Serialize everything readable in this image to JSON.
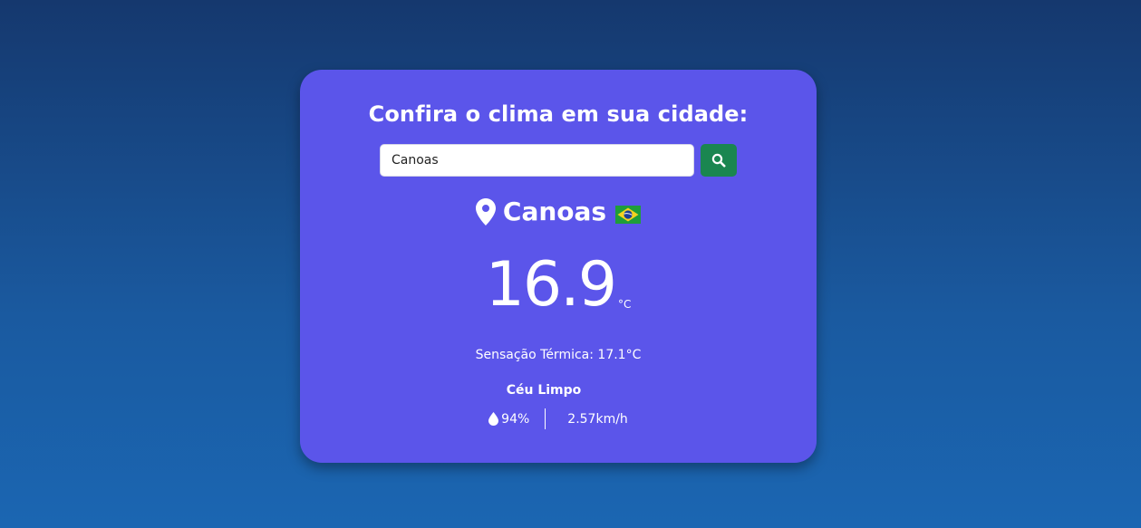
{
  "card": {
    "title": "Confira o clima em sua cidade:"
  },
  "search": {
    "value": "Canoas",
    "button_icon": "search-icon"
  },
  "location": {
    "city": "Canoas",
    "icon": "location-pin-icon",
    "flag": "brazil-flag-icon"
  },
  "weather": {
    "temperature": "16.9",
    "unit": "°C",
    "feels_like": "Sensação Térmica: 17.1°C",
    "condition": "Céu Limpo",
    "humidity": "94%",
    "humidity_icon": "water-drop-icon",
    "wind": "2.57km/h"
  },
  "colors": {
    "background_top": "#15386e",
    "background_bottom": "#1b66b2",
    "card": "#5b55ea",
    "search_button": "#1a8650",
    "text": "#ffffff"
  }
}
